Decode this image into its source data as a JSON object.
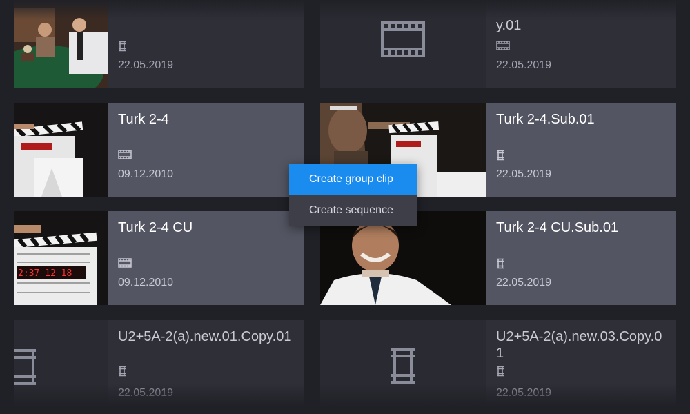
{
  "cards": [
    {
      "title": "",
      "type": "sequence",
      "date": "22.05.2019"
    },
    {
      "title": "y.01",
      "type": "clip",
      "date": "22.05.2019"
    },
    {
      "title": "Turk 2-4",
      "type": "clip",
      "date": "09.12.2010"
    },
    {
      "title": "Turk 2-4.Sub.01",
      "type": "sequence",
      "date": "22.05.2019"
    },
    {
      "title": "Turk 2-4 CU",
      "type": "clip",
      "date": "09.12.2010"
    },
    {
      "title": "Turk 2-4 CU.Sub.01",
      "type": "sequence",
      "date": "22.05.2019"
    },
    {
      "title": "U2+5A-2(a).new.01.Copy.01",
      "type": "sequence",
      "date": "22.05.2019"
    },
    {
      "title": "U2+5A-2(a).new.03.Copy.01",
      "type": "sequence",
      "date": "22.05.2019"
    }
  ],
  "context_menu": {
    "items": [
      {
        "label": "Create group clip",
        "active": true
      },
      {
        "label": "Create sequence",
        "active": false
      }
    ]
  },
  "icons": {
    "clip": "film-strip-icon",
    "sequence": "sequence-icon",
    "placeholder": "film-frame-placeholder-icon"
  },
  "colors": {
    "accent": "#1a8cf0",
    "background": "#202127",
    "card": "#2e2f37",
    "card_selected": "#535562"
  }
}
